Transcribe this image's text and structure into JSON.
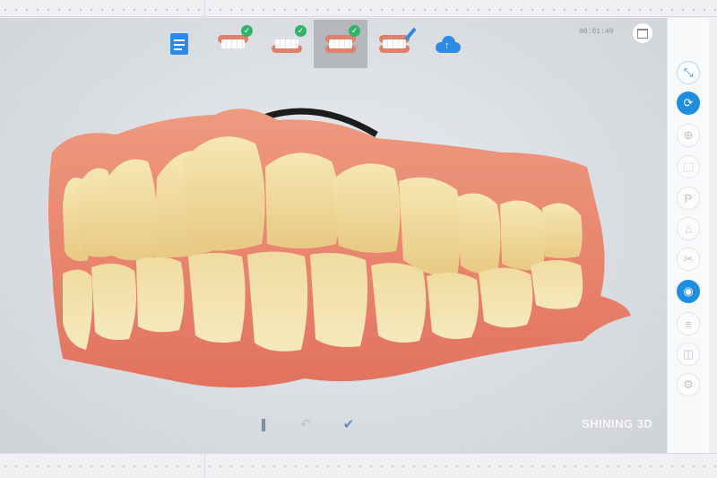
{
  "toolbar": {
    "steps": [
      {
        "name": "order-form",
        "icon": "document-icon",
        "completed": false,
        "selected": false
      },
      {
        "name": "upper-jaw-scan",
        "icon": "upper-jaw-icon",
        "completed": true,
        "selected": false
      },
      {
        "name": "lower-jaw-scan",
        "icon": "lower-jaw-icon",
        "completed": true,
        "selected": false
      },
      {
        "name": "bite-scan",
        "icon": "bite-icon",
        "completed": true,
        "selected": true
      },
      {
        "name": "edit",
        "icon": "edit-jaw-icon",
        "completed": false,
        "selected": false
      },
      {
        "name": "upload",
        "icon": "cloud-upload-icon",
        "completed": false,
        "selected": false
      }
    ],
    "check_glyph": "✓"
  },
  "status": {
    "timer": "00:01:49"
  },
  "watermark": "SHINING 3D",
  "bottom_controls": {
    "pause_glyph": "||",
    "undo_glyph": "↶",
    "confirm_glyph": "✔"
  },
  "right_toolbar": {
    "tools": [
      {
        "name": "fit-view",
        "glyph": "⤡",
        "state": "accent"
      },
      {
        "name": "rotate-view",
        "glyph": "⟳",
        "state": "active"
      },
      {
        "name": "align",
        "glyph": "⊕",
        "state": "normal"
      },
      {
        "name": "tooth-select",
        "glyph": "⬚",
        "state": "normal"
      },
      {
        "name": "text-note",
        "glyph": "P",
        "state": "normal"
      },
      {
        "name": "lock",
        "glyph": "⌂",
        "state": "normal"
      },
      {
        "name": "trim",
        "glyph": "✂",
        "state": "normal"
      },
      {
        "name": "texture-toggle",
        "glyph": "◉",
        "state": "active"
      },
      {
        "name": "measure",
        "glyph": "≡",
        "state": "normal"
      },
      {
        "name": "section",
        "glyph": "◫",
        "state": "normal"
      },
      {
        "name": "settings",
        "glyph": "⚙",
        "state": "normal"
      }
    ]
  },
  "colors": {
    "accent": "#1e8fe0",
    "check": "#2fb46a",
    "gum": "#e9826b",
    "tooth": "#f2dd9e"
  }
}
